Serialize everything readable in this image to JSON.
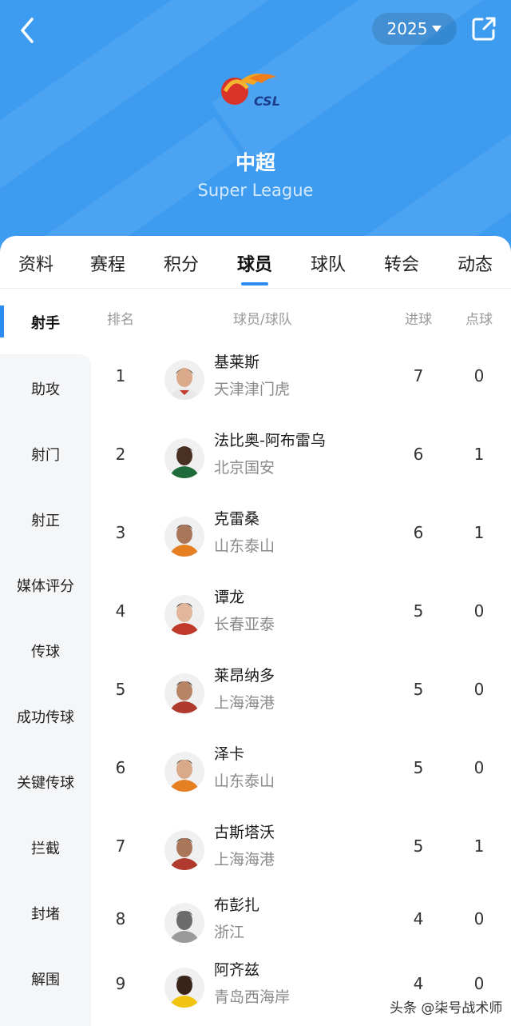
{
  "header": {
    "year": "2025",
    "league_cn": "中超",
    "league_en": "Super League",
    "logo_text": "CSL",
    "accent_color": "#3d9cf0"
  },
  "tabs": [
    "资料",
    "赛程",
    "积分",
    "球员",
    "球队",
    "转会",
    "动态"
  ],
  "active_tab": "球员",
  "sidebar": {
    "items": [
      "射手",
      "助攻",
      "射门",
      "射正",
      "媒体评分",
      "传球",
      "成功传球",
      "关键传球",
      "拦截",
      "封堵",
      "解围"
    ],
    "active": "射手"
  },
  "table": {
    "headers": {
      "rank": "排名",
      "player": "球员/球队",
      "goals": "进球",
      "penalties": "点球"
    },
    "rows": [
      {
        "rank": "1",
        "name": "基莱斯",
        "team": "天津津门虎",
        "goals": "7",
        "penalties": "0"
      },
      {
        "rank": "2",
        "name": "法比奥-阿布雷乌",
        "team": "北京国安",
        "goals": "6",
        "penalties": "1"
      },
      {
        "rank": "3",
        "name": "克雷桑",
        "team": "山东泰山",
        "goals": "6",
        "penalties": "1"
      },
      {
        "rank": "4",
        "name": "谭龙",
        "team": "长春亚泰",
        "goals": "5",
        "penalties": "0"
      },
      {
        "rank": "5",
        "name": "莱昂纳多",
        "team": "上海海港",
        "goals": "5",
        "penalties": "0"
      },
      {
        "rank": "6",
        "name": "泽卡",
        "team": "山东泰山",
        "goals": "5",
        "penalties": "0"
      },
      {
        "rank": "7",
        "name": "古斯塔沃",
        "team": "上海海港",
        "goals": "5",
        "penalties": "1"
      },
      {
        "rank": "8",
        "name": "布彭扎",
        "team": "浙江",
        "goals": "4",
        "penalties": "0"
      },
      {
        "rank": "9",
        "name": "阿齐兹",
        "team": "青岛西海岸",
        "goals": "4",
        "penalties": "0"
      }
    ]
  },
  "watermark": "头条 @柒号战术师"
}
